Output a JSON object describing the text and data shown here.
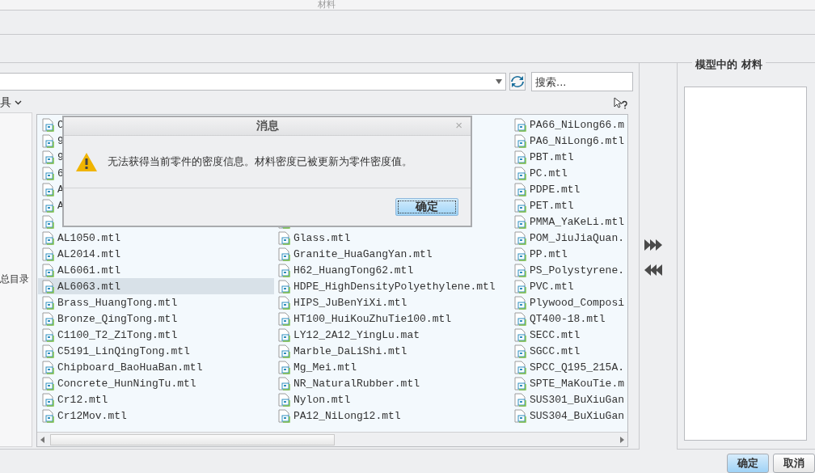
{
  "window": {
    "title": "材料"
  },
  "library": {
    "search": {
      "placeholder": "搜索..."
    },
    "toolbar_label": "具",
    "tree_label": "总目录",
    "columns": [
      [
        {
          "kind": "file",
          "name": "C",
          "selected": false
        },
        {
          "kind": "file",
          "name": "9",
          "selected": false
        },
        {
          "kind": "file",
          "name": "9",
          "selected": false
        },
        {
          "kind": "file",
          "name": "6",
          "selected": false
        },
        {
          "kind": "file",
          "name": "A",
          "selected": false
        },
        {
          "kind": "file",
          "name": "A",
          "selected": false
        },
        {
          "kind": "icon-only",
          "selected": false
        },
        {
          "kind": "file",
          "name": "AL1050.mtl",
          "selected": false
        },
        {
          "kind": "file",
          "name": "AL2014.mtl",
          "selected": false
        },
        {
          "kind": "file",
          "name": "AL6061.mtl",
          "selected": false
        },
        {
          "kind": "file",
          "name": "AL6063.mtl",
          "selected": true
        },
        {
          "kind": "file",
          "name": "Brass_HuangTong.mtl",
          "selected": false
        },
        {
          "kind": "file",
          "name": "Bronze_QingTong.mtl",
          "selected": false
        },
        {
          "kind": "file",
          "name": "C1100_T2_ZiTong.mtl",
          "selected": false
        },
        {
          "kind": "file",
          "name": "C5191_LinQingTong.mtl",
          "selected": false
        },
        {
          "kind": "file",
          "name": "Chipboard_BaoHuaBan.mtl",
          "selected": false
        },
        {
          "kind": "file",
          "name": "Concrete_HunNingTu.mtl",
          "selected": false
        },
        {
          "kind": "file",
          "name": "Cr12.mtl",
          "selected": false
        },
        {
          "kind": "file",
          "name": "Cr12Mov.mtl",
          "selected": false
        }
      ],
      [
        {
          "kind": "covered"
        },
        {
          "kind": "covered"
        },
        {
          "kind": "covered"
        },
        {
          "kind": "covered"
        },
        {
          "kind": "covered"
        },
        {
          "kind": "covered"
        },
        {
          "kind": "icon-only",
          "selected": false
        },
        {
          "kind": "file",
          "name": "Glass.mtl",
          "selected": false
        },
        {
          "kind": "file",
          "name": "Granite_HuaGangYan.mtl",
          "selected": false
        },
        {
          "kind": "file",
          "name": "H62_HuangTong62.mtl",
          "selected": false
        },
        {
          "kind": "file",
          "name": "HDPE_HighDensityPolyethylene.mtl",
          "selected": false
        },
        {
          "kind": "file",
          "name": "HIPS_JuBenYiXi.mtl",
          "selected": false
        },
        {
          "kind": "file",
          "name": "HT100_HuiKouZhuTie100.mtl",
          "selected": false
        },
        {
          "kind": "file",
          "name": "LY12_2A12_YingLu.mat",
          "selected": false
        },
        {
          "kind": "file",
          "name": "Marble_DaLiShi.mtl",
          "selected": false
        },
        {
          "kind": "file",
          "name": "Mg_Mei.mtl",
          "selected": false
        },
        {
          "kind": "file",
          "name": "NR_NaturalRubber.mtl",
          "selected": false
        },
        {
          "kind": "file",
          "name": "Nylon.mtl",
          "selected": false
        },
        {
          "kind": "file",
          "name": "PA12_NiLong12.mtl",
          "selected": false
        }
      ],
      [
        {
          "kind": "file",
          "name": "PA66_NiLong66.m",
          "selected": false
        },
        {
          "kind": "file",
          "name": "PA6_NiLong6.mtl",
          "selected": false
        },
        {
          "kind": "file",
          "name": "PBT.mtl",
          "selected": false
        },
        {
          "kind": "file",
          "name": "PC.mtl",
          "selected": false
        },
        {
          "kind": "file",
          "name": "PDPE.mtl",
          "selected": false
        },
        {
          "kind": "file",
          "name": "PET.mtl",
          "selected": false
        },
        {
          "kind": "file",
          "name": "PMMA_YaKeLi.mtl",
          "selected": false
        },
        {
          "kind": "file",
          "name": "POM_JiuJiaQuan.",
          "selected": false
        },
        {
          "kind": "file",
          "name": "PP.mtl",
          "selected": false
        },
        {
          "kind": "file",
          "name": "PS_Polystyrene.",
          "selected": false
        },
        {
          "kind": "file",
          "name": "PVC.mtl",
          "selected": false
        },
        {
          "kind": "file",
          "name": "Plywood_Composi",
          "selected": false
        },
        {
          "kind": "file",
          "name": "QT400-18.mtl",
          "selected": false
        },
        {
          "kind": "file",
          "name": "SECC.mtl",
          "selected": false
        },
        {
          "kind": "file",
          "name": "SGCC.mtl",
          "selected": false
        },
        {
          "kind": "file",
          "name": "SPCC_Q195_215A.",
          "selected": false
        },
        {
          "kind": "file",
          "name": "SPTE_MaKouTie.m",
          "selected": false
        },
        {
          "kind": "file",
          "name": "SUS301_BuXiuGan",
          "selected": false
        },
        {
          "kind": "file",
          "name": "SUS304_BuXiuGan",
          "selected": false
        }
      ]
    ]
  },
  "model_materials": {
    "title": "模型中的 材料"
  },
  "buttons": [
    "确定",
    "取消"
  ],
  "dialog": {
    "title": "消息",
    "close": "×",
    "message": "无法获得当前零件的密度信息。材料密度已被更新为零件密度值。",
    "button": "确定"
  }
}
